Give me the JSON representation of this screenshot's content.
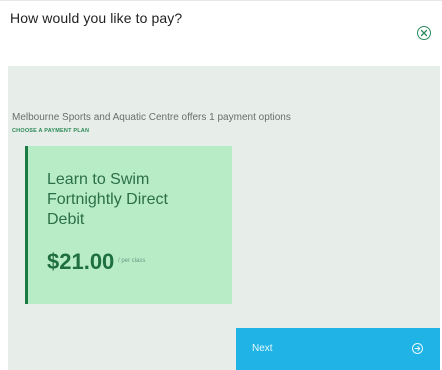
{
  "dialog": {
    "title": "How would you like to pay?"
  },
  "offer": {
    "text": "Melbourne Sports and Aquatic Centre offers 1 payment options",
    "choose_label": "CHOOSE A PAYMENT PLAN"
  },
  "plans": [
    {
      "name": "Learn to Swim Fortnightly Direct Debit",
      "price": "$21.00",
      "unit": "/ per class"
    }
  ],
  "actions": {
    "next_label": "Next"
  },
  "icons": {
    "close": "close-circle-icon",
    "next": "arrow-right-circle-icon"
  },
  "colors": {
    "accent_green": "#1d7a45",
    "card_bg": "#b8ecc7",
    "panel_bg": "#e7ede9",
    "next_button": "#1fb3e6"
  }
}
